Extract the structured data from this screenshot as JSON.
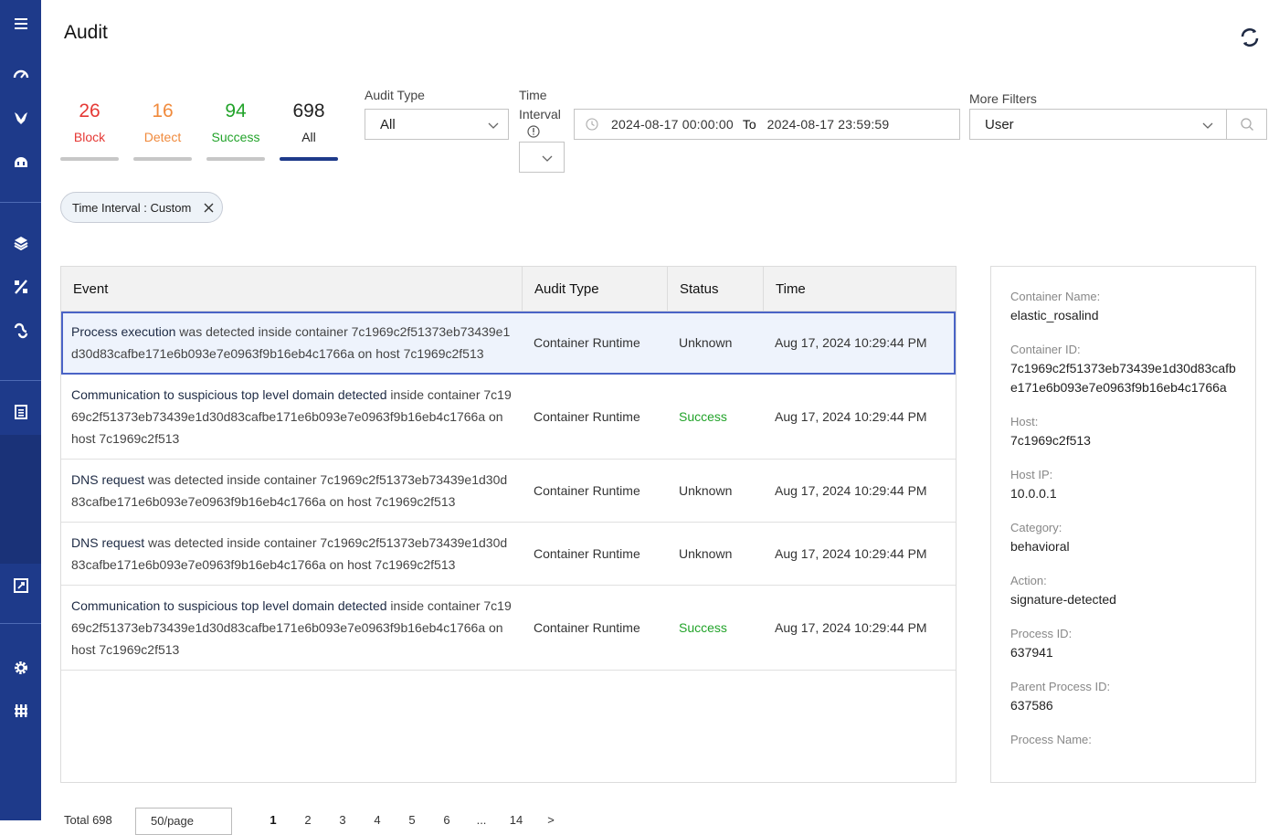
{
  "page": {
    "title": "Audit"
  },
  "stats": [
    {
      "count": "26",
      "label": "Block",
      "color": "#e53935"
    },
    {
      "count": "16",
      "label": "Detect",
      "color": "#f08a3c"
    },
    {
      "count": "94",
      "label": "Success",
      "color": "#22a32a"
    },
    {
      "count": "698",
      "label": "All",
      "color": "#222222"
    }
  ],
  "filters": {
    "audit_type": {
      "label": "Audit Type",
      "value": "All"
    },
    "time_interval": {
      "label_line1": "Time",
      "label_line2": "Interval",
      "value": ""
    },
    "date_range": {
      "from": "2024-08-17 00:00:00",
      "separator": "To",
      "to": "2024-08-17 23:59:59"
    },
    "more_filters": {
      "label": "More Filters",
      "value": "User"
    }
  },
  "chip": {
    "label": "Time Interval : Custom"
  },
  "table": {
    "headers": {
      "event": "Event",
      "audit_type": "Audit Type",
      "status": "Status",
      "time": "Time"
    },
    "rows": [
      {
        "event_strong": "Process execution",
        "event_rest": " was detected inside container 7c1969c2f51373eb73439e1d30d83cafbe171e6b093e7e0963f9b16eb4c1766a on host 7c1969c2f513",
        "audit_type": "Container Runtime",
        "status": "Unknown",
        "time": "Aug 17, 2024 10:29:44 PM"
      },
      {
        "event_strong": "Communication to suspicious top level domain detected",
        "event_rest": " inside container 7c1969c2f51373eb73439e1d30d83cafbe171e6b093e7e0963f9b16eb4c1766a on host 7c1969c2f513",
        "audit_type": "Container Runtime",
        "status": "Success",
        "time": "Aug 17, 2024 10:29:44 PM"
      },
      {
        "event_strong": "DNS request",
        "event_rest": " was detected inside container 7c1969c2f51373eb73439e1d30d83cafbe171e6b093e7e0963f9b16eb4c1766a on host 7c1969c2f513",
        "audit_type": "Container Runtime",
        "status": "Unknown",
        "time": "Aug 17, 2024 10:29:44 PM"
      },
      {
        "event_strong": "DNS request",
        "event_rest": " was detected inside container 7c1969c2f51373eb73439e1d30d83cafbe171e6b093e7e0963f9b16eb4c1766a on host 7c1969c2f513",
        "audit_type": "Container Runtime",
        "status": "Unknown",
        "time": "Aug 17, 2024 10:29:44 PM"
      },
      {
        "event_strong": "Communication to suspicious top level domain detected",
        "event_rest": " inside container 7c1969c2f51373eb73439e1d30d83cafbe171e6b093e7e0963f9b16eb4c1766a on host 7c1969c2f513",
        "audit_type": "Container Runtime",
        "status": "Success",
        "time": "Aug 17, 2024 10:29:44 PM"
      }
    ]
  },
  "detail": {
    "fields": [
      {
        "label": "Container Name:",
        "value": "elastic_rosalind"
      },
      {
        "label": "Container ID:",
        "value": "7c1969c2f51373eb73439e1d30d83cafbe171e6b093e7e0963f9b16eb4c1766a"
      },
      {
        "label": "Host:",
        "value": "7c1969c2f513"
      },
      {
        "label": "Host IP:",
        "value": "10.0.0.1"
      },
      {
        "label": "Category:",
        "value": "behavioral"
      },
      {
        "label": "Action:",
        "value": "signature-detected"
      },
      {
        "label": "Process ID:",
        "value": "637941"
      },
      {
        "label": "Parent Process ID:",
        "value": "637586"
      },
      {
        "label": "Process Name:",
        "value": ""
      }
    ]
  },
  "pagination": {
    "total": "Total 698",
    "page_size": "50/page",
    "pages": [
      "1",
      "2",
      "3",
      "4",
      "5",
      "6",
      "...",
      "14",
      ">"
    ]
  }
}
